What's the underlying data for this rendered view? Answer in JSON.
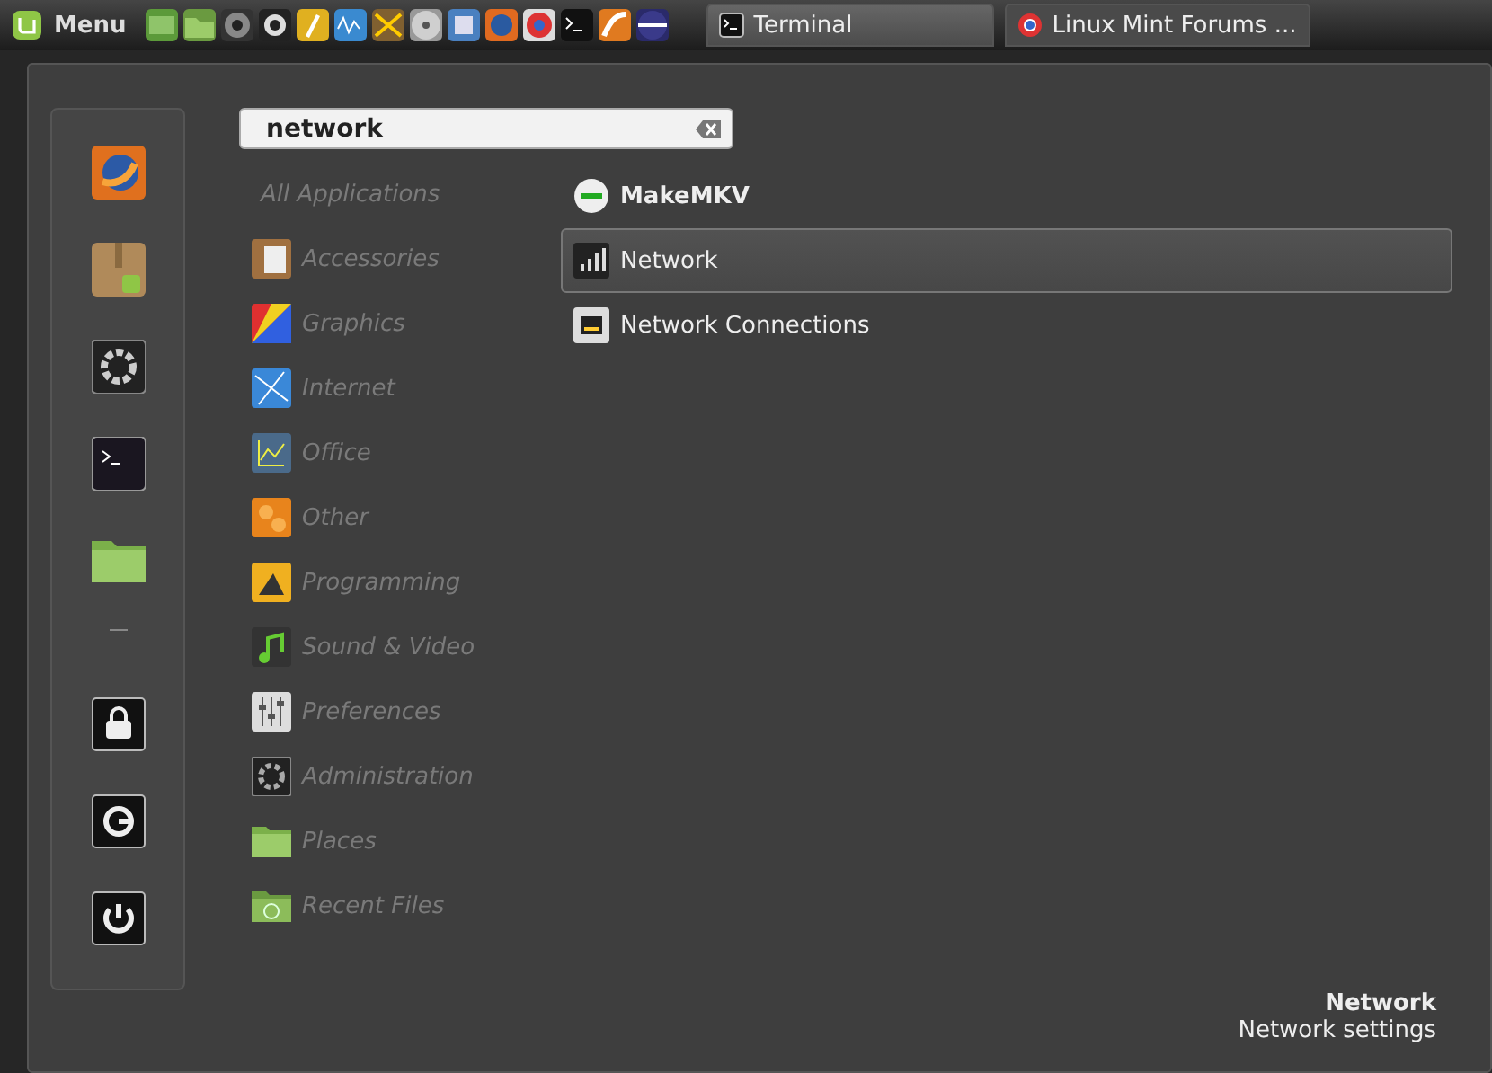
{
  "panel": {
    "menu_label": "Menu",
    "tasks": [
      {
        "label": "Terminal",
        "selected": true
      },
      {
        "label": "Linux Mint Forums ...",
        "selected": false
      }
    ]
  },
  "menu": {
    "search": {
      "value": "network"
    },
    "categories": [
      {
        "label": "All Applications",
        "disabled": true
      },
      {
        "label": "Accessories",
        "disabled": true
      },
      {
        "label": "Graphics",
        "disabled": true
      },
      {
        "label": "Internet",
        "disabled": true
      },
      {
        "label": "Office",
        "disabled": true
      },
      {
        "label": "Other",
        "disabled": true
      },
      {
        "label": "Programming",
        "disabled": true
      },
      {
        "label": "Sound & Video",
        "disabled": true
      },
      {
        "label": "Preferences",
        "disabled": true
      },
      {
        "label": "Administration",
        "disabled": true
      },
      {
        "label": "Places",
        "disabled": true
      },
      {
        "label": "Recent Files",
        "disabled": true
      }
    ],
    "results": [
      {
        "label": "MakeMKV",
        "bold": true,
        "selected": false
      },
      {
        "label": "Network",
        "bold": false,
        "selected": true
      },
      {
        "label": "Network Connections",
        "bold": false,
        "selected": false
      }
    ],
    "description": {
      "title": "Network",
      "subtitle": "Network settings"
    }
  }
}
